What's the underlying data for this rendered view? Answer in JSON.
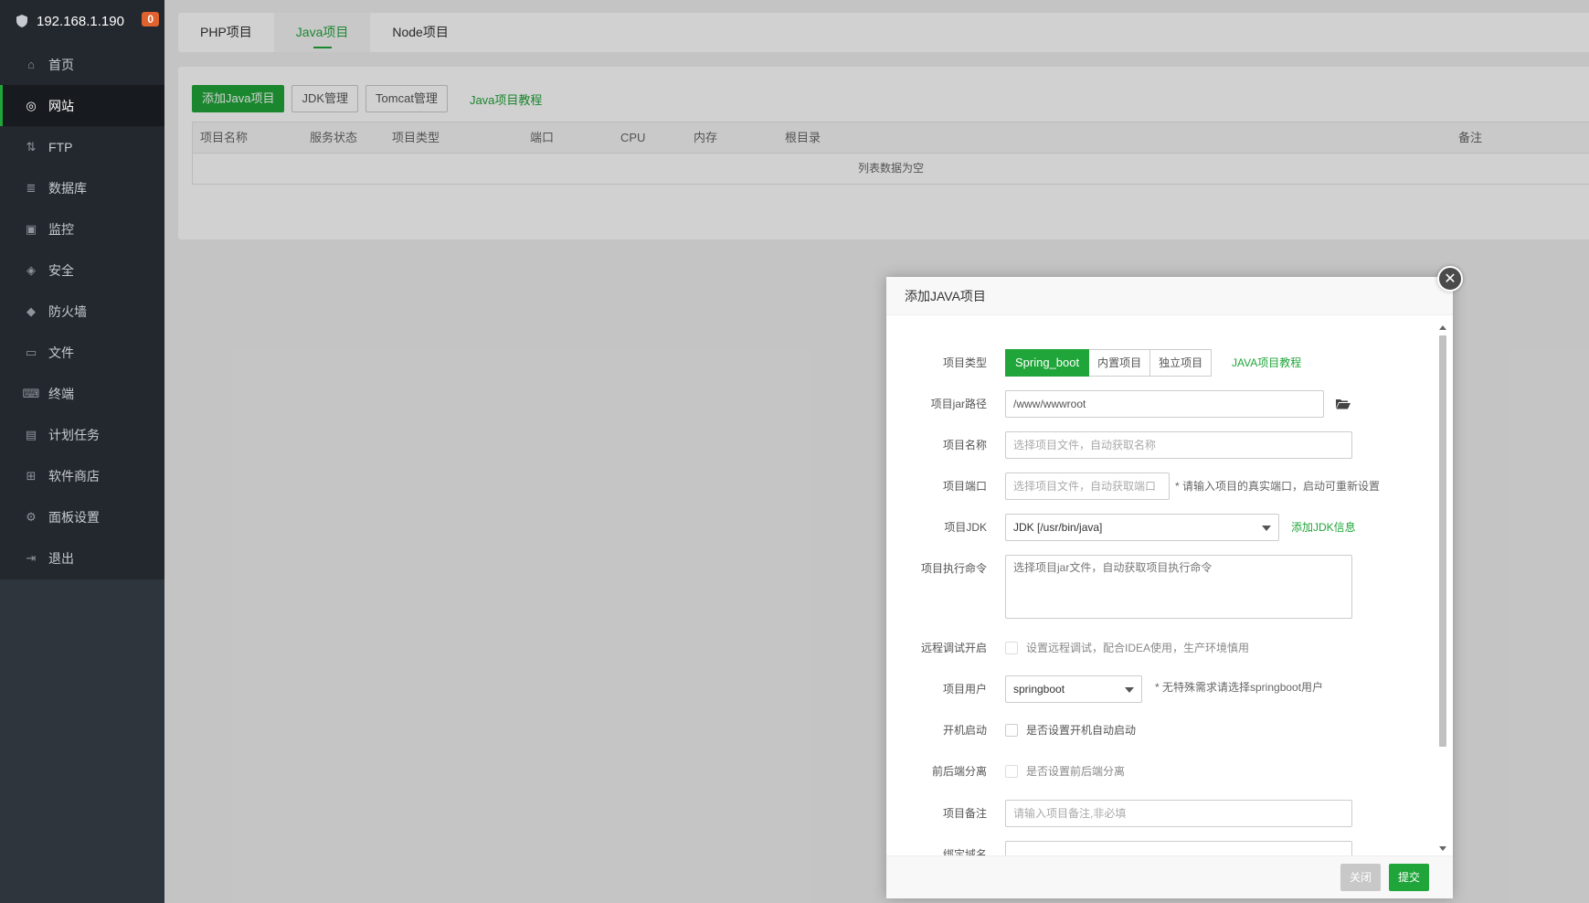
{
  "sidebar": {
    "host": "192.168.1.190",
    "badge": "0",
    "items": [
      {
        "label": "首页",
        "icon": "home-icon"
      },
      {
        "label": "网站",
        "icon": "globe-icon"
      },
      {
        "label": "FTP",
        "icon": "ftp-icon"
      },
      {
        "label": "数据库",
        "icon": "database-icon"
      },
      {
        "label": "监控",
        "icon": "monitor-icon"
      },
      {
        "label": "安全",
        "icon": "shield-check-icon"
      },
      {
        "label": "防火墙",
        "icon": "firewall-icon"
      },
      {
        "label": "文件",
        "icon": "folder-icon"
      },
      {
        "label": "终端",
        "icon": "terminal-icon"
      },
      {
        "label": "计划任务",
        "icon": "calendar-icon"
      },
      {
        "label": "软件商店",
        "icon": "apps-icon"
      },
      {
        "label": "面板设置",
        "icon": "gear-icon"
      },
      {
        "label": "退出",
        "icon": "logout-icon"
      }
    ]
  },
  "tabs": [
    "PHP项目",
    "Java项目",
    "Node项目"
  ],
  "toolbar": {
    "add": "添加Java项目",
    "jdk": "JDK管理",
    "tomcat": "Tomcat管理",
    "tutorial": "Java项目教程"
  },
  "table": {
    "columns": [
      "项目名称",
      "服务状态",
      "项目类型",
      "端口",
      "CPU",
      "内存",
      "根目录",
      "备注"
    ],
    "empty": "列表数据为空"
  },
  "modal": {
    "title": "添加JAVA项目",
    "type_label": "项目类型",
    "type_options": [
      "Spring_boot",
      "内置项目",
      "独立项目"
    ],
    "type_tutorial": "JAVA项目教程",
    "jar_label": "项目jar路径",
    "jar_value": "/www/wwwroot",
    "name_label": "项目名称",
    "name_placeholder": "选择项目文件，自动获取名称",
    "port_label": "项目端口",
    "port_placeholder": "选择项目文件，自动获取端口",
    "port_hint": "* 请输入项目的真实端口，启动可重新设置",
    "jdk_label": "项目JDK",
    "jdk_value": "JDK [/usr/bin/java]",
    "jdk_add": "添加JDK信息",
    "cmd_label": "项目执行命令",
    "cmd_placeholder": "选择项目jar文件，自动获取项目执行命令",
    "debug_label": "远程调试开启",
    "debug_text": "设置远程调试，配合IDEA使用，生产环境慎用",
    "user_label": "项目用户",
    "user_value": "springboot",
    "user_hint": "* 无特殊需求请选择springboot用户",
    "boot_label": "开机启动",
    "boot_text": "是否设置开机自动启动",
    "split_label": "前后端分离",
    "split_text": "是否设置前后端分离",
    "remark_label": "项目备注",
    "remark_placeholder": "请输入项目备注,非必填",
    "domain_label": "绑定域名",
    "close": "关闭",
    "submit": "提交"
  },
  "colors": {
    "accent": "#20a53a",
    "sidebar": "#23272e",
    "badge": "#e0622e"
  }
}
